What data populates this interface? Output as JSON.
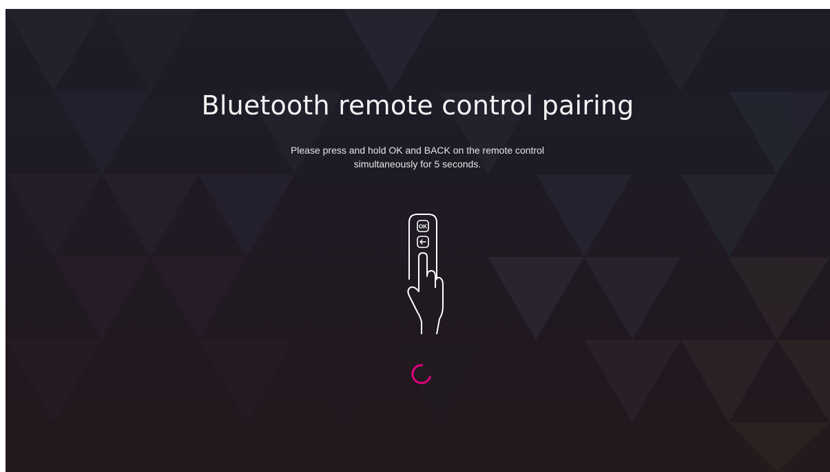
{
  "screen": {
    "title": "Bluetooth remote control pairing",
    "instruction": "Please press and hold OK and BACK on the remote control\nsimultaneously for 5 seconds."
  },
  "illustration": {
    "ok_button_label": "OK",
    "back_button_icon": "back-arrow-icon",
    "hand_icon": "pointing-hand-icon"
  },
  "spinner": {
    "color": "#e2007a",
    "state": "loading"
  },
  "colors": {
    "background_dark": "#1c1d27",
    "text": "#f2f2f2",
    "accent": "#e2007a"
  }
}
